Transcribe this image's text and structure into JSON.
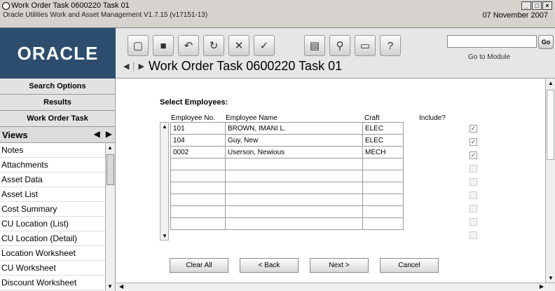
{
  "window": {
    "title": "Work Order Task 0600220 Task 01",
    "subtitle": "Oracle Utilities Work and Asset Management V1.7.15 (v17151-13)",
    "date": "07 November 2007"
  },
  "logo": {
    "text": "ORACLE"
  },
  "toolbar": {
    "icons": [
      "new-document-icon",
      "save-icon",
      "undo-icon",
      "refresh-icon",
      "delete-icon",
      "spell-check-icon",
      "report-icon",
      "attachments-icon",
      "inbox-icon",
      "help-icon"
    ]
  },
  "module": {
    "placeholder": "",
    "go_label": "Go",
    "label": "Go to Module"
  },
  "page": {
    "heading": "Work Order Task 0600220 Task 01"
  },
  "leftnav": {
    "tabs": [
      "Search Options",
      "Results",
      "Work Order Task"
    ],
    "views_label": "Views",
    "items": [
      "Notes",
      "Attachments",
      "Asset Data",
      "Asset List",
      "Cost Summary",
      "CU Location (List)",
      "CU Location (Detail)",
      "Location Worksheet",
      "CU Worksheet",
      "Discount Worksheet"
    ]
  },
  "main": {
    "section_title": "Select Employees:",
    "columns": [
      "Employee No.",
      "Employee Name",
      "Craft",
      "Include?"
    ],
    "rows": [
      {
        "no": "101",
        "name": "BROWN, IMANI L.",
        "craft": "ELEC",
        "include": true
      },
      {
        "no": "104",
        "name": "Guy, New",
        "craft": "ELEC",
        "include": true
      },
      {
        "no": "0002",
        "name": "Userson, Newious",
        "craft": "MECH",
        "include": true
      },
      {
        "no": "",
        "name": "",
        "craft": "",
        "include": false
      },
      {
        "no": "",
        "name": "",
        "craft": "",
        "include": false
      },
      {
        "no": "",
        "name": "",
        "craft": "",
        "include": false
      },
      {
        "no": "",
        "name": "",
        "craft": "",
        "include": false
      },
      {
        "no": "",
        "name": "",
        "craft": "",
        "include": false
      },
      {
        "no": "",
        "name": "",
        "craft": "",
        "include": false
      }
    ],
    "buttons": {
      "clear_all": "Clear All",
      "back": "< Back",
      "next": "Next >",
      "cancel": "Cancel"
    }
  }
}
